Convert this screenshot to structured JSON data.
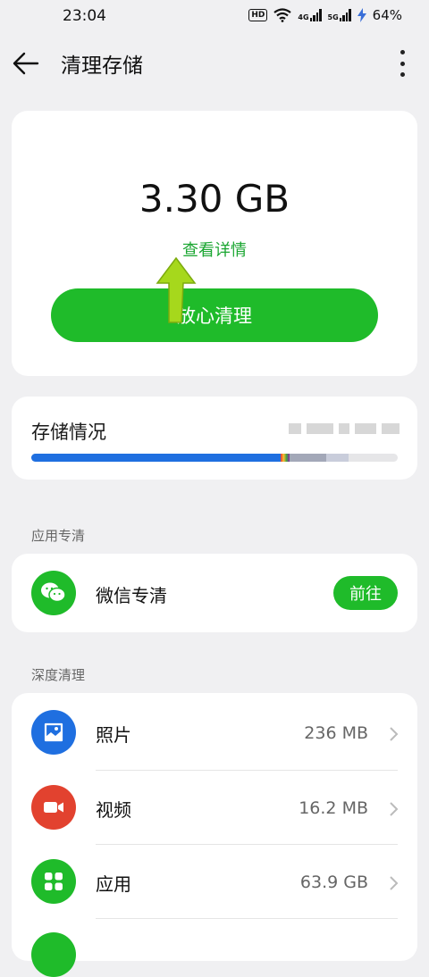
{
  "status": {
    "time": "23:04",
    "hd": "HD",
    "net1": "4G",
    "net2": "5G",
    "battery": "64%"
  },
  "header": {
    "title": "清理存储"
  },
  "summary": {
    "size": "3.30 GB",
    "detail_link": "查看详情",
    "clean_button": "放心清理"
  },
  "storage": {
    "label": "存储情况"
  },
  "app_section": {
    "label": "应用专清",
    "items": [
      {
        "label": "微信专清",
        "action": "前往"
      }
    ]
  },
  "deep_section": {
    "label": "深度清理",
    "items": [
      {
        "label": "照片",
        "size": "236 MB",
        "icon": "photo-icon",
        "color": "#1f6fe0"
      },
      {
        "label": "视频",
        "size": "16.2 MB",
        "icon": "video-icon",
        "color": "#e2422f"
      },
      {
        "label": "应用",
        "size": "63.9 GB",
        "icon": "apps-grid-icon",
        "color": "#1fbb2a"
      }
    ]
  },
  "colors": {
    "accent_green": "#1fbb2a",
    "link_green": "#1aa631",
    "storage_blue": "#1f6fe0"
  }
}
